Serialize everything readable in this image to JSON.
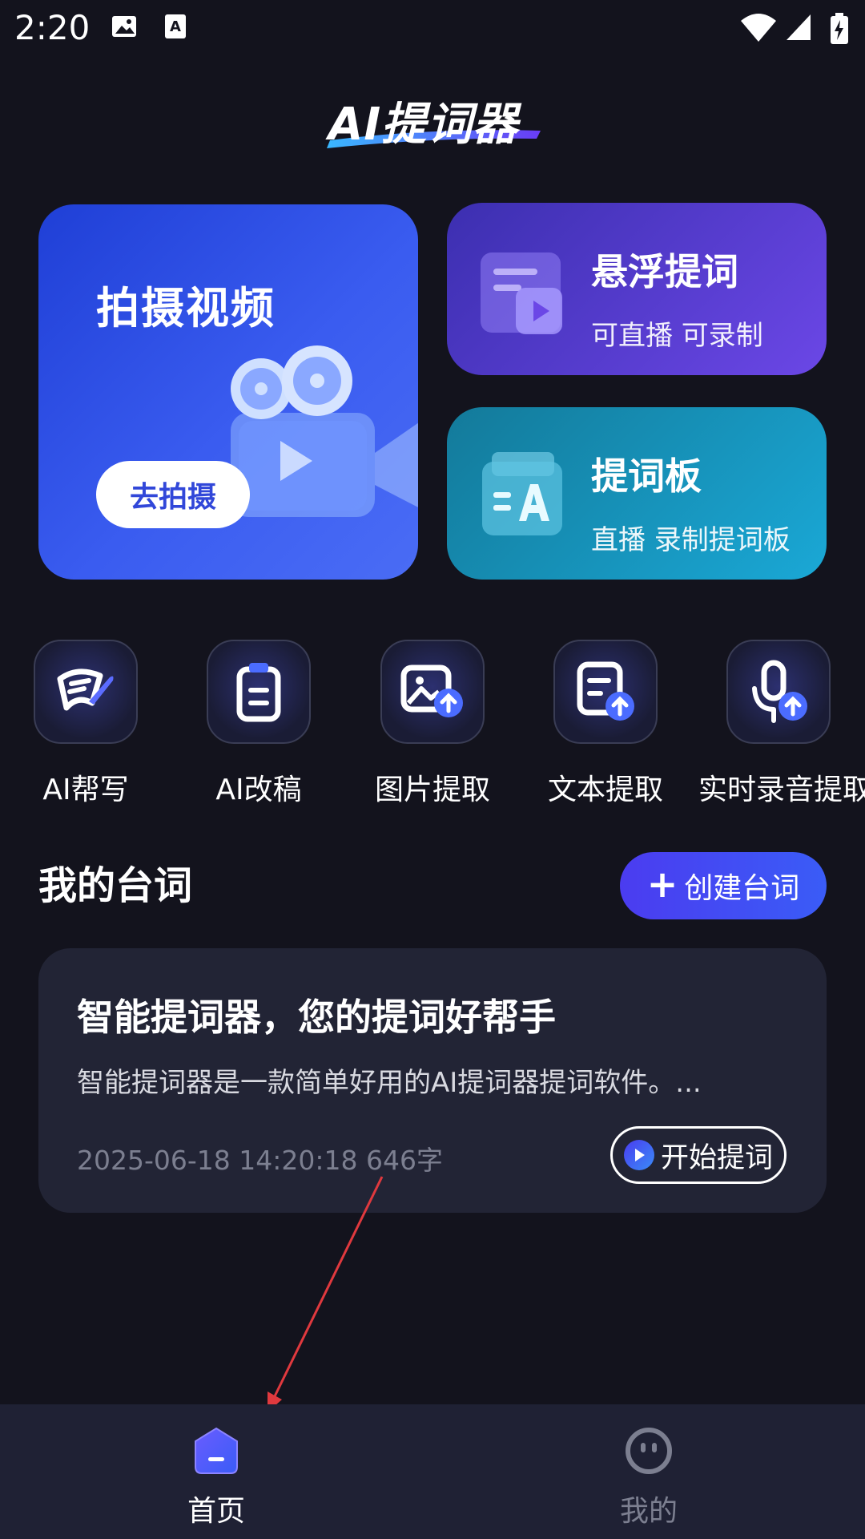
{
  "status_bar": {
    "time": "2:20",
    "icons": [
      "image-icon",
      "text-icon",
      "wifi-icon",
      "signal-icon",
      "battery-icon"
    ]
  },
  "app": {
    "logo_text": "AI提词器"
  },
  "cards": {
    "shoot": {
      "title": "拍摄视频",
      "button": "去拍摄"
    },
    "float": {
      "title": "悬浮提词",
      "subtitle": "可直播 可录制"
    },
    "board": {
      "title": "提词板",
      "subtitle": "直播 录制提词板"
    }
  },
  "tools": [
    {
      "label": "AI帮写",
      "icon": "pen-paper-icon"
    },
    {
      "label": "AI改稿",
      "icon": "clipboard-icon"
    },
    {
      "label": "图片提取",
      "icon": "image-upload-icon"
    },
    {
      "label": "文本提取",
      "icon": "document-upload-icon"
    },
    {
      "label": "实时录音提取",
      "icon": "microphone-upload-icon"
    }
  ],
  "scripts": {
    "title": "我的台词",
    "create_label": "创建台词",
    "items": [
      {
        "title": "智能提词器，您的提词好帮手",
        "desc": "智能提词器是一款简单好用的AI提词器提词软件。...",
        "meta": "2025-06-18 14:20:18 646字",
        "action": "开始提词"
      }
    ]
  },
  "bottom_nav": [
    {
      "label": "首页",
      "icon": "home-icon",
      "active": true
    },
    {
      "label": "我的",
      "icon": "profile-icon",
      "active": false
    }
  ],
  "colors": {
    "background": "#13131d",
    "accent": "#4b3cf0",
    "nav_active": "#ffffff",
    "nav_inactive": "#7c7f90",
    "arrow": "#e0393e"
  }
}
